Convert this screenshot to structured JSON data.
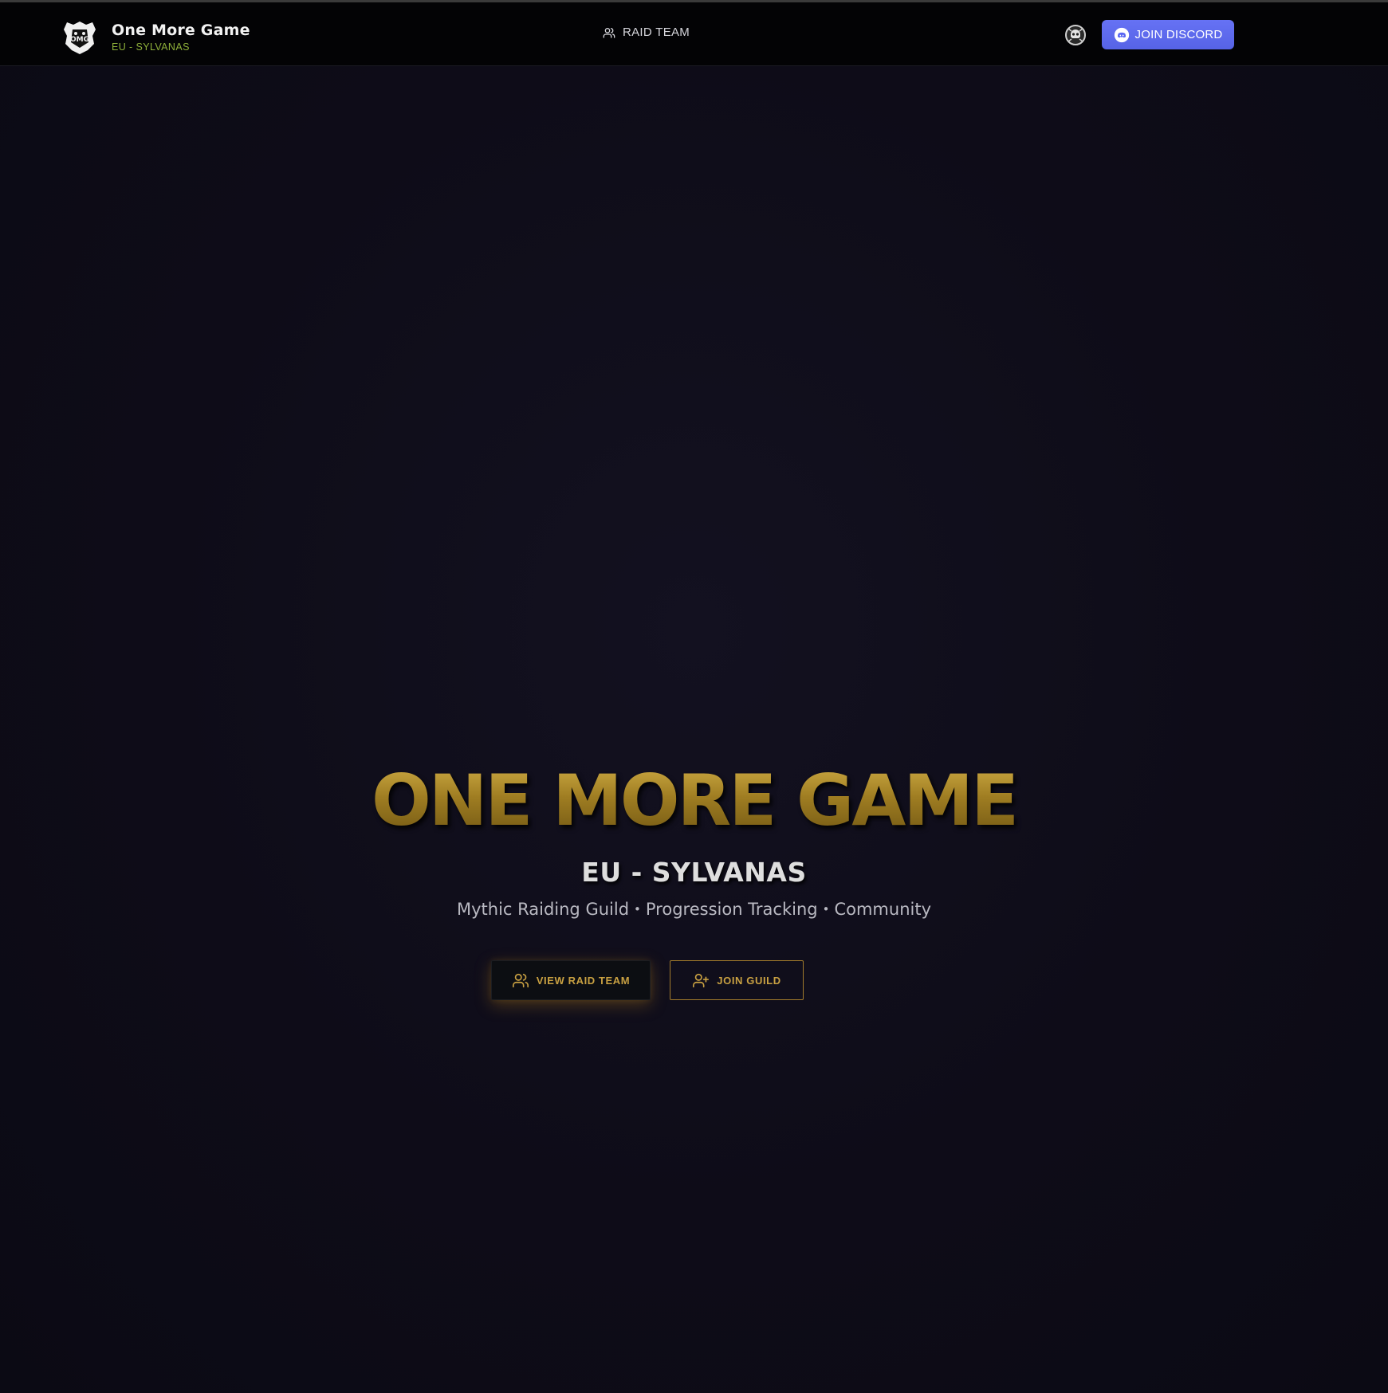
{
  "nav": {
    "brand_name": "One More Game",
    "brand_realm": "EU - SYLVANAS",
    "logo_icon": "omg-crest-icon",
    "links": [
      {
        "label": "RAID TEAM",
        "icon": "users-icon"
      }
    ],
    "avatar_icon": "skull-avatar-icon",
    "discord_label": "JOIN DISCORD",
    "discord_icon": "discord-icon"
  },
  "hero": {
    "title": "ONE MORE GAME",
    "subtitle": "EU - SYLVANAS",
    "tagline": [
      "Mythic Raiding Guild",
      "Progression Tracking",
      "Community"
    ],
    "tagline_separator": "•",
    "primary_button": {
      "label": "VIEW RAID TEAM",
      "icon": "users-icon"
    },
    "secondary_button": {
      "label": "JOIN GUILD",
      "icon": "user-plus-icon"
    }
  },
  "colors": {
    "gold": "#c9a142",
    "discord": "#5865f2",
    "realm_green": "#8fb13a",
    "background": "#0e0c18"
  }
}
